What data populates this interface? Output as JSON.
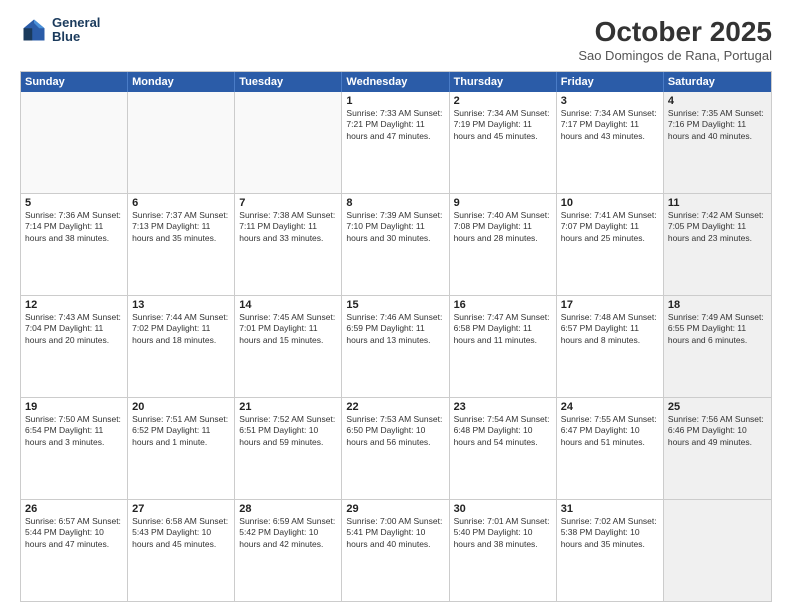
{
  "logo": {
    "line1": "General",
    "line2": "Blue"
  },
  "header": {
    "title": "October 2025",
    "location": "Sao Domingos de Rana, Portugal"
  },
  "dayHeaders": [
    "Sunday",
    "Monday",
    "Tuesday",
    "Wednesday",
    "Thursday",
    "Friday",
    "Saturday"
  ],
  "weeks": [
    [
      {
        "day": "",
        "info": "",
        "empty": true
      },
      {
        "day": "",
        "info": "",
        "empty": true
      },
      {
        "day": "",
        "info": "",
        "empty": true
      },
      {
        "day": "1",
        "info": "Sunrise: 7:33 AM\nSunset: 7:21 PM\nDaylight: 11 hours\nand 47 minutes."
      },
      {
        "day": "2",
        "info": "Sunrise: 7:34 AM\nSunset: 7:19 PM\nDaylight: 11 hours\nand 45 minutes."
      },
      {
        "day": "3",
        "info": "Sunrise: 7:34 AM\nSunset: 7:17 PM\nDaylight: 11 hours\nand 43 minutes."
      },
      {
        "day": "4",
        "info": "Sunrise: 7:35 AM\nSunset: 7:16 PM\nDaylight: 11 hours\nand 40 minutes.",
        "shaded": true
      }
    ],
    [
      {
        "day": "5",
        "info": "Sunrise: 7:36 AM\nSunset: 7:14 PM\nDaylight: 11 hours\nand 38 minutes."
      },
      {
        "day": "6",
        "info": "Sunrise: 7:37 AM\nSunset: 7:13 PM\nDaylight: 11 hours\nand 35 minutes."
      },
      {
        "day": "7",
        "info": "Sunrise: 7:38 AM\nSunset: 7:11 PM\nDaylight: 11 hours\nand 33 minutes."
      },
      {
        "day": "8",
        "info": "Sunrise: 7:39 AM\nSunset: 7:10 PM\nDaylight: 11 hours\nand 30 minutes."
      },
      {
        "day": "9",
        "info": "Sunrise: 7:40 AM\nSunset: 7:08 PM\nDaylight: 11 hours\nand 28 minutes."
      },
      {
        "day": "10",
        "info": "Sunrise: 7:41 AM\nSunset: 7:07 PM\nDaylight: 11 hours\nand 25 minutes."
      },
      {
        "day": "11",
        "info": "Sunrise: 7:42 AM\nSunset: 7:05 PM\nDaylight: 11 hours\nand 23 minutes.",
        "shaded": true
      }
    ],
    [
      {
        "day": "12",
        "info": "Sunrise: 7:43 AM\nSunset: 7:04 PM\nDaylight: 11 hours\nand 20 minutes."
      },
      {
        "day": "13",
        "info": "Sunrise: 7:44 AM\nSunset: 7:02 PM\nDaylight: 11 hours\nand 18 minutes."
      },
      {
        "day": "14",
        "info": "Sunrise: 7:45 AM\nSunset: 7:01 PM\nDaylight: 11 hours\nand 15 minutes."
      },
      {
        "day": "15",
        "info": "Sunrise: 7:46 AM\nSunset: 6:59 PM\nDaylight: 11 hours\nand 13 minutes."
      },
      {
        "day": "16",
        "info": "Sunrise: 7:47 AM\nSunset: 6:58 PM\nDaylight: 11 hours\nand 11 minutes."
      },
      {
        "day": "17",
        "info": "Sunrise: 7:48 AM\nSunset: 6:57 PM\nDaylight: 11 hours\nand 8 minutes."
      },
      {
        "day": "18",
        "info": "Sunrise: 7:49 AM\nSunset: 6:55 PM\nDaylight: 11 hours\nand 6 minutes.",
        "shaded": true
      }
    ],
    [
      {
        "day": "19",
        "info": "Sunrise: 7:50 AM\nSunset: 6:54 PM\nDaylight: 11 hours\nand 3 minutes."
      },
      {
        "day": "20",
        "info": "Sunrise: 7:51 AM\nSunset: 6:52 PM\nDaylight: 11 hours\nand 1 minute."
      },
      {
        "day": "21",
        "info": "Sunrise: 7:52 AM\nSunset: 6:51 PM\nDaylight: 10 hours\nand 59 minutes."
      },
      {
        "day": "22",
        "info": "Sunrise: 7:53 AM\nSunset: 6:50 PM\nDaylight: 10 hours\nand 56 minutes."
      },
      {
        "day": "23",
        "info": "Sunrise: 7:54 AM\nSunset: 6:48 PM\nDaylight: 10 hours\nand 54 minutes."
      },
      {
        "day": "24",
        "info": "Sunrise: 7:55 AM\nSunset: 6:47 PM\nDaylight: 10 hours\nand 51 minutes."
      },
      {
        "day": "25",
        "info": "Sunrise: 7:56 AM\nSunset: 6:46 PM\nDaylight: 10 hours\nand 49 minutes.",
        "shaded": true
      }
    ],
    [
      {
        "day": "26",
        "info": "Sunrise: 6:57 AM\nSunset: 5:44 PM\nDaylight: 10 hours\nand 47 minutes."
      },
      {
        "day": "27",
        "info": "Sunrise: 6:58 AM\nSunset: 5:43 PM\nDaylight: 10 hours\nand 45 minutes."
      },
      {
        "day": "28",
        "info": "Sunrise: 6:59 AM\nSunset: 5:42 PM\nDaylight: 10 hours\nand 42 minutes."
      },
      {
        "day": "29",
        "info": "Sunrise: 7:00 AM\nSunset: 5:41 PM\nDaylight: 10 hours\nand 40 minutes."
      },
      {
        "day": "30",
        "info": "Sunrise: 7:01 AM\nSunset: 5:40 PM\nDaylight: 10 hours\nand 38 minutes."
      },
      {
        "day": "31",
        "info": "Sunrise: 7:02 AM\nSunset: 5:38 PM\nDaylight: 10 hours\nand 35 minutes."
      },
      {
        "day": "",
        "info": "",
        "empty": true,
        "shaded": true
      }
    ]
  ]
}
